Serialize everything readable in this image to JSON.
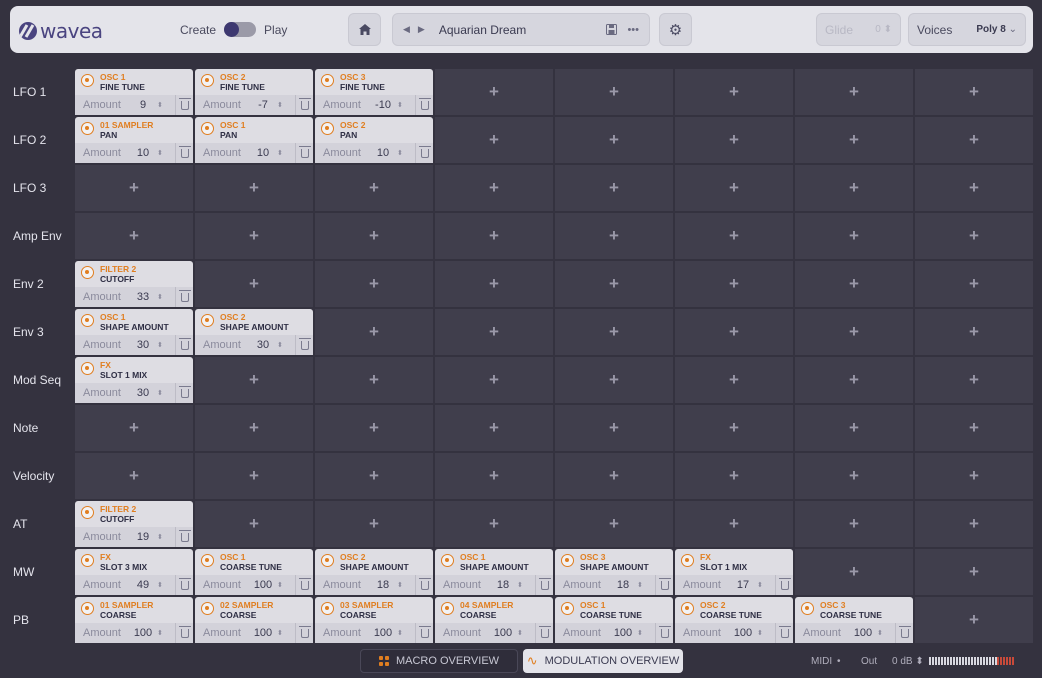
{
  "header": {
    "logo_text": "wavea",
    "mode_left": "Create",
    "mode_right": "Play",
    "preset_name": "Aquarian Dream",
    "glide_label": "Glide",
    "glide_value": "0",
    "voices_label": "Voices",
    "voices_value": "Poly 8"
  },
  "rows": [
    {
      "label": "LFO 1",
      "cells": [
        {
          "src": "OSC 1",
          "dst": "FINE TUNE",
          "amount": "9"
        },
        {
          "src": "OSC 2",
          "dst": "FINE TUNE",
          "amount": "-7"
        },
        {
          "src": "OSC 3",
          "dst": "FINE TUNE",
          "amount": "-10"
        },
        null,
        null,
        null,
        null,
        null
      ]
    },
    {
      "label": "LFO 2",
      "cells": [
        {
          "src": "01 SAMPLER",
          "dst": "PAN",
          "amount": "10"
        },
        {
          "src": "OSC 1",
          "dst": "PAN",
          "amount": "10"
        },
        {
          "src": "OSC 2",
          "dst": "PAN",
          "amount": "10"
        },
        null,
        null,
        null,
        null,
        null
      ]
    },
    {
      "label": "LFO 3",
      "cells": [
        null,
        null,
        null,
        null,
        null,
        null,
        null,
        null
      ]
    },
    {
      "label": "Amp Env",
      "cells": [
        null,
        null,
        null,
        null,
        null,
        null,
        null,
        null
      ]
    },
    {
      "label": "Env 2",
      "cells": [
        {
          "src": "FILTER 2",
          "dst": "CUTOFF",
          "amount": "33"
        },
        null,
        null,
        null,
        null,
        null,
        null,
        null
      ]
    },
    {
      "label": "Env 3",
      "cells": [
        {
          "src": "OSC 1",
          "dst": "SHAPE AMOUNT",
          "amount": "30"
        },
        {
          "src": "OSC 2",
          "dst": "SHAPE AMOUNT",
          "amount": "30"
        },
        null,
        null,
        null,
        null,
        null,
        null
      ]
    },
    {
      "label": "Mod Seq",
      "cells": [
        {
          "src": "FX",
          "dst": "SLOT 1 MIX",
          "amount": "30"
        },
        null,
        null,
        null,
        null,
        null,
        null,
        null
      ]
    },
    {
      "label": "Note",
      "cells": [
        null,
        null,
        null,
        null,
        null,
        null,
        null,
        null
      ]
    },
    {
      "label": "Velocity",
      "cells": [
        null,
        null,
        null,
        null,
        null,
        null,
        null,
        null
      ]
    },
    {
      "label": "AT",
      "cells": [
        {
          "src": "FILTER 2",
          "dst": "CUTOFF",
          "amount": "19"
        },
        null,
        null,
        null,
        null,
        null,
        null,
        null
      ]
    },
    {
      "label": "MW",
      "cells": [
        {
          "src": "FX",
          "dst": "SLOT 3 MIX",
          "amount": "49"
        },
        {
          "src": "OSC 1",
          "dst": "COARSE TUNE",
          "amount": "100"
        },
        {
          "src": "OSC 2",
          "dst": "SHAPE AMOUNT",
          "amount": "18"
        },
        {
          "src": "OSC 1",
          "dst": "SHAPE AMOUNT",
          "amount": "18"
        },
        {
          "src": "OSC 3",
          "dst": "SHAPE AMOUNT",
          "amount": "18"
        },
        {
          "src": "FX",
          "dst": "SLOT 1 MIX",
          "amount": "17"
        },
        null,
        null
      ]
    },
    {
      "label": "PB",
      "cells": [
        {
          "src": "01 SAMPLER",
          "dst": "COARSE",
          "amount": "100"
        },
        {
          "src": "02 SAMPLER",
          "dst": "COARSE",
          "amount": "100"
        },
        {
          "src": "03 SAMPLER",
          "dst": "COARSE",
          "amount": "100"
        },
        {
          "src": "04 SAMPLER",
          "dst": "COARSE",
          "amount": "100"
        },
        {
          "src": "OSC 1",
          "dst": "COARSE TUNE",
          "amount": "100"
        },
        {
          "src": "OSC 2",
          "dst": "COARSE TUNE",
          "amount": "100"
        },
        {
          "src": "OSC 3",
          "dst": "COARSE TUNE",
          "amount": "100"
        },
        null
      ]
    }
  ],
  "amount_label": "Amount",
  "empty_glyph": "+",
  "footer": {
    "macro_tab": "MACRO OVERVIEW",
    "mod_tab": "MODULATION OVERVIEW",
    "midi_label": "MIDI",
    "out_label": "Out",
    "out_value": "0 dB"
  },
  "colors": {
    "accent": "#e07e20",
    "brand": "#4a4480",
    "background": "#34323f",
    "cell_empty": "#403e4c",
    "cell_filled": "#dedde3"
  }
}
